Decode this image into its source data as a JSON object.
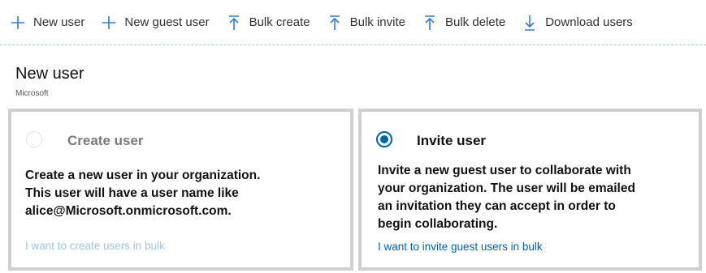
{
  "toolbar": {
    "items": [
      {
        "label": "New user",
        "icon": "plus-icon"
      },
      {
        "label": "New guest user",
        "icon": "plus-icon"
      },
      {
        "label": "Bulk create",
        "icon": "upload-icon"
      },
      {
        "label": "Bulk invite",
        "icon": "upload-icon"
      },
      {
        "label": "Bulk delete",
        "icon": "upload-icon"
      },
      {
        "label": "Download users",
        "icon": "download-icon"
      }
    ]
  },
  "header": {
    "title": "New user",
    "subtitle": "Microsoft"
  },
  "options": [
    {
      "title": "Create user",
      "selected": false,
      "description_lines": [
        "Create a new user in your organization.",
        "This user will have a user name like",
        "alice@Microsoft.onmicrosoft.com."
      ],
      "link": "I want to create users in bulk"
    },
    {
      "title": "Invite user",
      "selected": true,
      "description_lines": [
        "Invite a new guest user to collaborate with",
        "your organization. The user will be emailed",
        "an invitation they can accept in order to",
        "begin collaborating."
      ],
      "link": "I want to invite guest users in bulk"
    }
  ],
  "colors": {
    "accent": "#0063b1",
    "toolbar_icon": "#2b7cd3",
    "card_border": "#cfcfcf",
    "disabled_link": "#9fc6e9"
  }
}
